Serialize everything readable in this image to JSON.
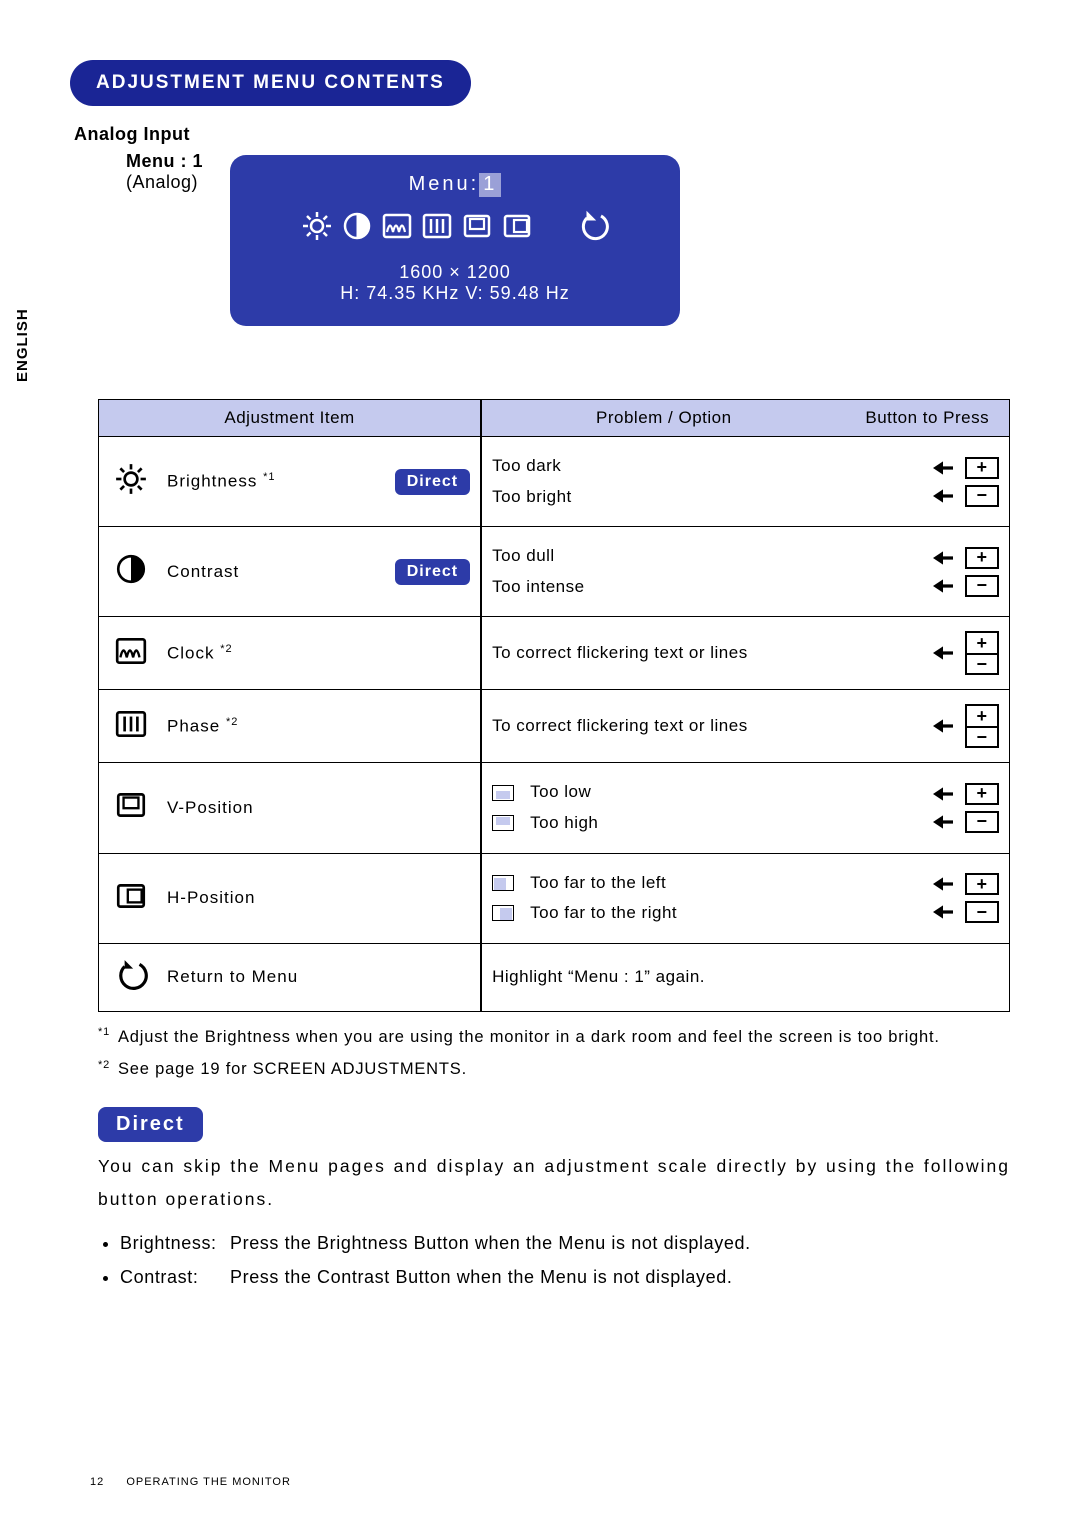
{
  "title": "ADJUSTMENT MENU CONTENTS",
  "subtitle": "Analog Input",
  "menu_label": "Menu : 1",
  "analog_label": "(Analog)",
  "side_tab": "ENGLISH",
  "osd": {
    "menu_prefix": "Menu:",
    "menu_number": "1",
    "resolution": "1600 × 1200",
    "freq": "H: 74.35 KHz  V: 59.48 Hz"
  },
  "table": {
    "headers": {
      "item": "Adjustment Item",
      "problem": "Problem / Option",
      "button": "Button to Press"
    },
    "direct_label": "Direct",
    "rows": {
      "brightness": {
        "name": "Brightness",
        "note": "*1",
        "too_dark": "Too dark",
        "too_bright": "Too bright"
      },
      "contrast": {
        "name": "Contrast",
        "too_dull": "Too dull",
        "too_intense": "Too intense"
      },
      "clock": {
        "name": "Clock",
        "note": "*2",
        "desc": "To correct flickering text or lines"
      },
      "phase": {
        "name": "Phase",
        "note": "*2",
        "desc": "To correct flickering text or lines"
      },
      "vpos": {
        "name": "V-Position",
        "too_low": "Too low",
        "too_high": "Too high"
      },
      "hpos": {
        "name": "H-Position",
        "too_left": "Too far to the left",
        "too_right": "Too far to the right"
      },
      "return": {
        "name": "Return to Menu",
        "desc": "Highlight “Menu : 1” again."
      }
    }
  },
  "footnotes": {
    "n1_marker": "*1",
    "n1": "Adjust the Brightness when you are using the monitor in a dark room and feel the screen is too bright.",
    "n2_marker": "*2",
    "n2": "See page 19 for SCREEN ADJUSTMENTS."
  },
  "direct_section": {
    "pill": "Direct",
    "intro": "You can skip the Menu pages and display an adjustment scale directly by using the following button operations.",
    "items": {
      "brightness_label": "Brightness:",
      "brightness_text": "Press the Brightness Button when the Menu is not displayed.",
      "contrast_label": "Contrast:",
      "contrast_text": "Press the Contrast Button when the Menu is not displayed."
    }
  },
  "footer": {
    "page": "12",
    "section": "OPERATING THE MONITOR"
  },
  "glyphs": {
    "plus": "+",
    "minus": "−"
  }
}
